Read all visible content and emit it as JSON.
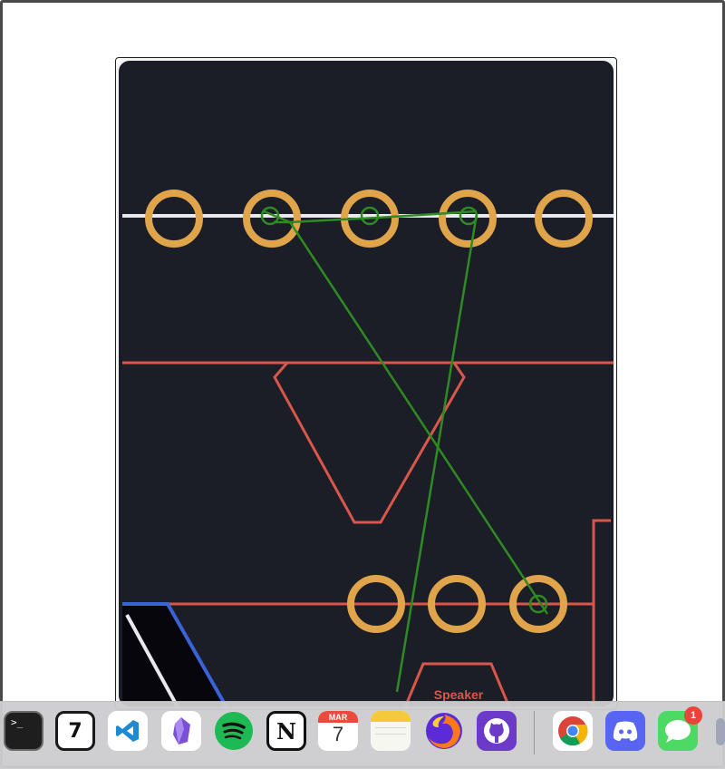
{
  "board": {
    "speaker_label": "Speaker",
    "colors": {
      "background": "#1c1e27",
      "pad": "#e0a54a",
      "outline": "#d9574a",
      "trace": "#2e8a22",
      "keepout": "#3a63d8",
      "rail": "#ffffff"
    }
  },
  "dock": {
    "items": [
      {
        "name": "terminal-icon",
        "label": ">_"
      },
      {
        "name": "calendar-7-icon",
        "label": "7"
      },
      {
        "name": "vscode-icon",
        "label": ""
      },
      {
        "name": "obsidian-icon",
        "label": ""
      },
      {
        "name": "spotify-icon",
        "label": ""
      },
      {
        "name": "notion-icon",
        "label": "N"
      },
      {
        "name": "calendar-icon",
        "month": "MAR",
        "day": "7"
      },
      {
        "name": "notes-icon",
        "label": ""
      },
      {
        "name": "firefox-icon",
        "label": ""
      },
      {
        "name": "github-icon",
        "label": ""
      },
      {
        "name": "chrome-icon",
        "label": ""
      },
      {
        "name": "discord-icon",
        "label": ""
      },
      {
        "name": "messages-icon",
        "label": ""
      }
    ],
    "messages_badge": "1"
  }
}
